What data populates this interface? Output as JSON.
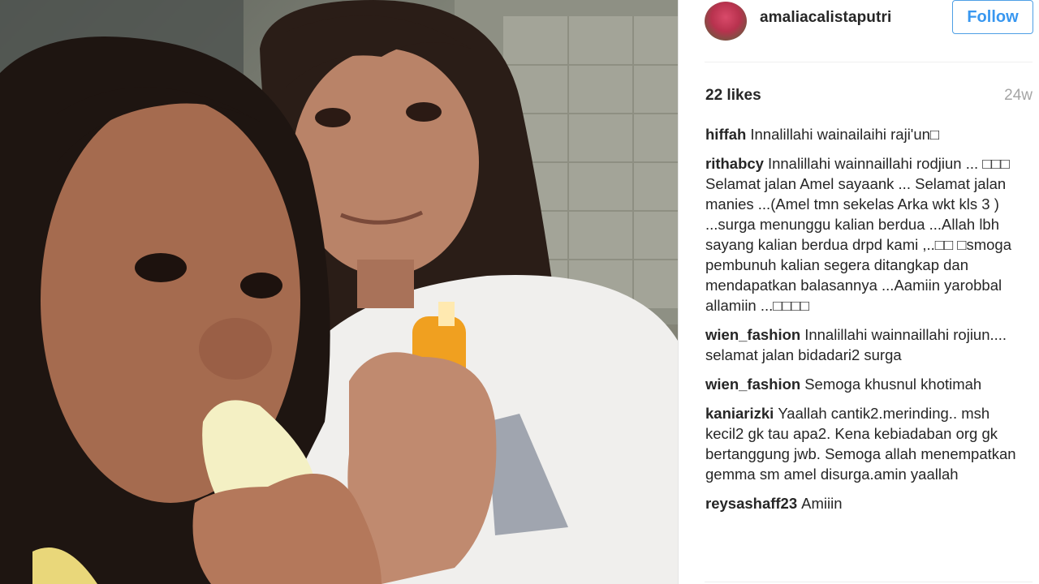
{
  "post": {
    "username": "amaliacalistaputri",
    "follow_label": "Follow",
    "likes": "22 likes",
    "time_ago": "24w"
  },
  "comments": [
    {
      "author": "hiffah",
      "text": "Innalillahi wainailaihi raji'un□"
    },
    {
      "author": "rithabcy",
      "text": "Innalillahi wainnaillahi rodjiun ... □□□ Selamat jalan Amel sayaank ... Selamat jalan manies ...(Amel tmn sekelas Arka wkt kls 3 ) ...surga menunggu kalian berdua ...Allah lbh sayang kalian berdua drpd kami ,..□□ □smoga pembunuh kalian segera ditangkap dan mendapatkan balasannya ...Aamiin yarobbal allamiin ...□□□□"
    },
    {
      "author": "wien_fashion",
      "text": "Innalillahi wainnaillahi rojiun.... selamat jalan bidadari2 surga"
    },
    {
      "author": "wien_fashion",
      "text": "Semoga khusnul khotimah"
    },
    {
      "author": "kaniarizki",
      "text": "Yaallah cantik2.merinding.. msh kecil2 gk tau apa2. Kena kebiadaban org gk bertanggung jwb. Semoga allah menempatkan gemma sm amel disurga.amin yaallah"
    },
    {
      "author": "reysashaff23",
      "text": "Amiiin"
    }
  ]
}
